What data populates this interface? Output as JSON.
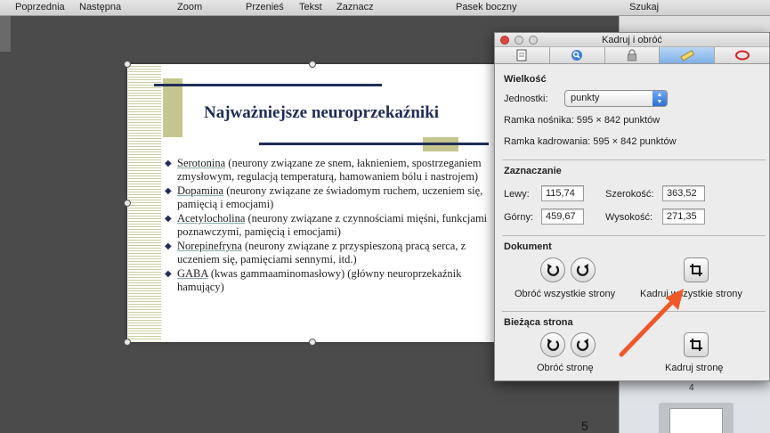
{
  "toolbar": {
    "previous": "Poprzednia",
    "next": "Następna",
    "zoom": "Zoom",
    "move": "Przenieś",
    "text": "Tekst",
    "select": "Zaznacz",
    "sidebar": "Pasek boczny",
    "search": "Szukaj"
  },
  "slide": {
    "title": "Najważniejsze neuroprzekaźniki",
    "items": [
      {
        "term": "Serotonina",
        "rest": " (neurony związane ze snem, łaknieniem, spostrzeganiem zmysłowym, regulacją temperaturą, hamowaniem bólu i nastrojem)"
      },
      {
        "term": "Dopamina",
        "rest": " (neurony związane ze świadomym ruchem, uczeniem się, pamięcią i emocjami)"
      },
      {
        "term": "Acetylocholina",
        "rest": " (neurony związane z czynnościami mięśni, funkcjami poznawczymi, pamięcią i emocjami)"
      },
      {
        "term": "Norepinefryna",
        "rest": " (neurony związane z przyspieszoną pracą serca, z uczeniem się, pamięciami sennymi, itd.)"
      },
      {
        "term": "GABA",
        "rest": " (kwas gammaaminomasłowy) (główny neuroprzekaźnik hamujący)"
      }
    ]
  },
  "page_number": "5",
  "sidebar": {
    "thumb_label": "4"
  },
  "inspector": {
    "title": "Kadruj i obróć",
    "size_section": "Wielkość",
    "units_label": "Jednostki:",
    "units_value": "punkty",
    "media_box": "Ramka nośnika: 595 × 842 punktów",
    "crop_box": "Ramka kadrowania: 595 × 842 punktów",
    "selection_section": "Zaznaczanie",
    "left_label": "Lewy:",
    "left_value": "115,74",
    "width_label": "Szerokość:",
    "width_value": "363,52",
    "top_label": "Górny:",
    "top_value": "459,67",
    "height_label": "Wysokość:",
    "height_value": "271,35",
    "document_section": "Dokument",
    "rotate_all": "Obróć wszystkie strony",
    "crop_all": "Kadruj wszystkie strony",
    "current_section": "Bieżąca strona",
    "rotate_page": "Obróć stronę",
    "crop_page": "Kadruj stronę"
  },
  "colors": {
    "accent_tab": "#7fb0e8",
    "annotation_arrow": "#f0582a",
    "slide_navy": "#1f2d57",
    "slide_olive": "#c5c68e"
  },
  "icons": {
    "tabs": [
      "document-icon",
      "magnifier-icon",
      "lock-icon",
      "ruler-icon",
      "oval-icon"
    ],
    "rotate_left": "rotate-left-icon",
    "rotate_right": "rotate-right-icon",
    "crop": "crop-icon"
  }
}
